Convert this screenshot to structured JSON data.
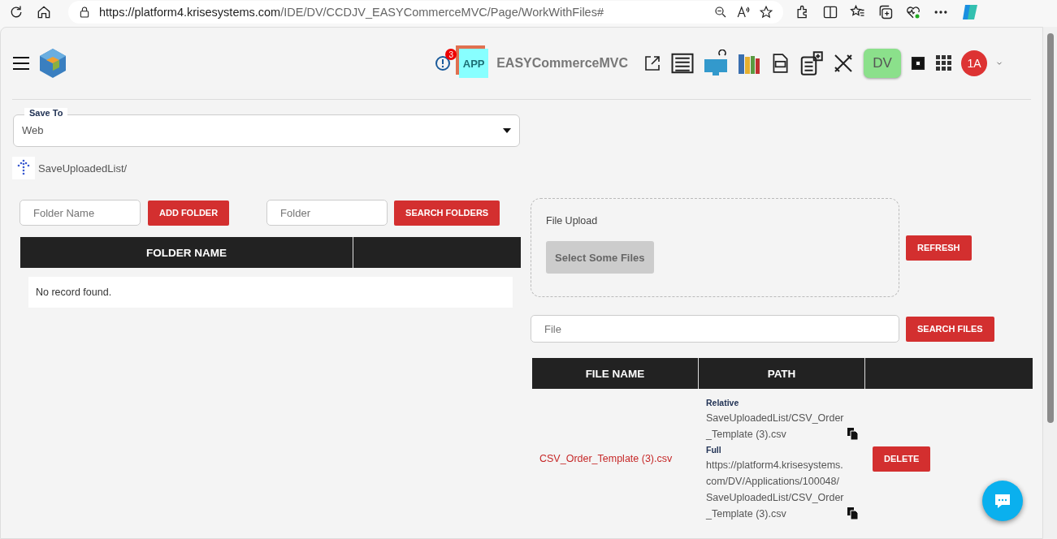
{
  "browser": {
    "url_host": "https://platform4.krisesystems.com",
    "url_path": "/IDE/DV/CCDJV_EASYCommerceMVC/Page/WorkWithFiles#"
  },
  "header": {
    "notification_count": "3",
    "app_icon_text": "APP",
    "app_name": "EASYCommerceMVC",
    "env_badge": "DV",
    "avatar": "1A"
  },
  "save_to": {
    "label": "Save To",
    "value": "Web"
  },
  "breadcrumb": "SaveUploadedList/",
  "folder_tools": {
    "folder_name_placeholder": "Folder Name",
    "add_button": "ADD FOLDER",
    "folder_placeholder": "Folder",
    "search_button": "SEARCH FOLDERS"
  },
  "folder_table": {
    "columns": [
      "FOLDER NAME"
    ],
    "empty_text": "No record found."
  },
  "upload": {
    "label": "File Upload",
    "select_button": "Select Some Files",
    "refresh_button": "REFRESH"
  },
  "file_search": {
    "placeholder": "File",
    "button": "SEARCH FILES"
  },
  "file_table": {
    "columns": [
      "FILE NAME",
      "PATH"
    ],
    "rows": [
      {
        "file_name": "CSV_Order_Template (3).csv",
        "relative_label": "Relative",
        "relative_path": "SaveUploadedList/CSV_Order_Template (3).csv",
        "full_label": "Full",
        "full_path": "https://platform4.krisesystems.com/DV/Applications/100048/SaveUploadedList/CSV_Order_Template (3).csv",
        "action": "DELETE"
      }
    ]
  }
}
